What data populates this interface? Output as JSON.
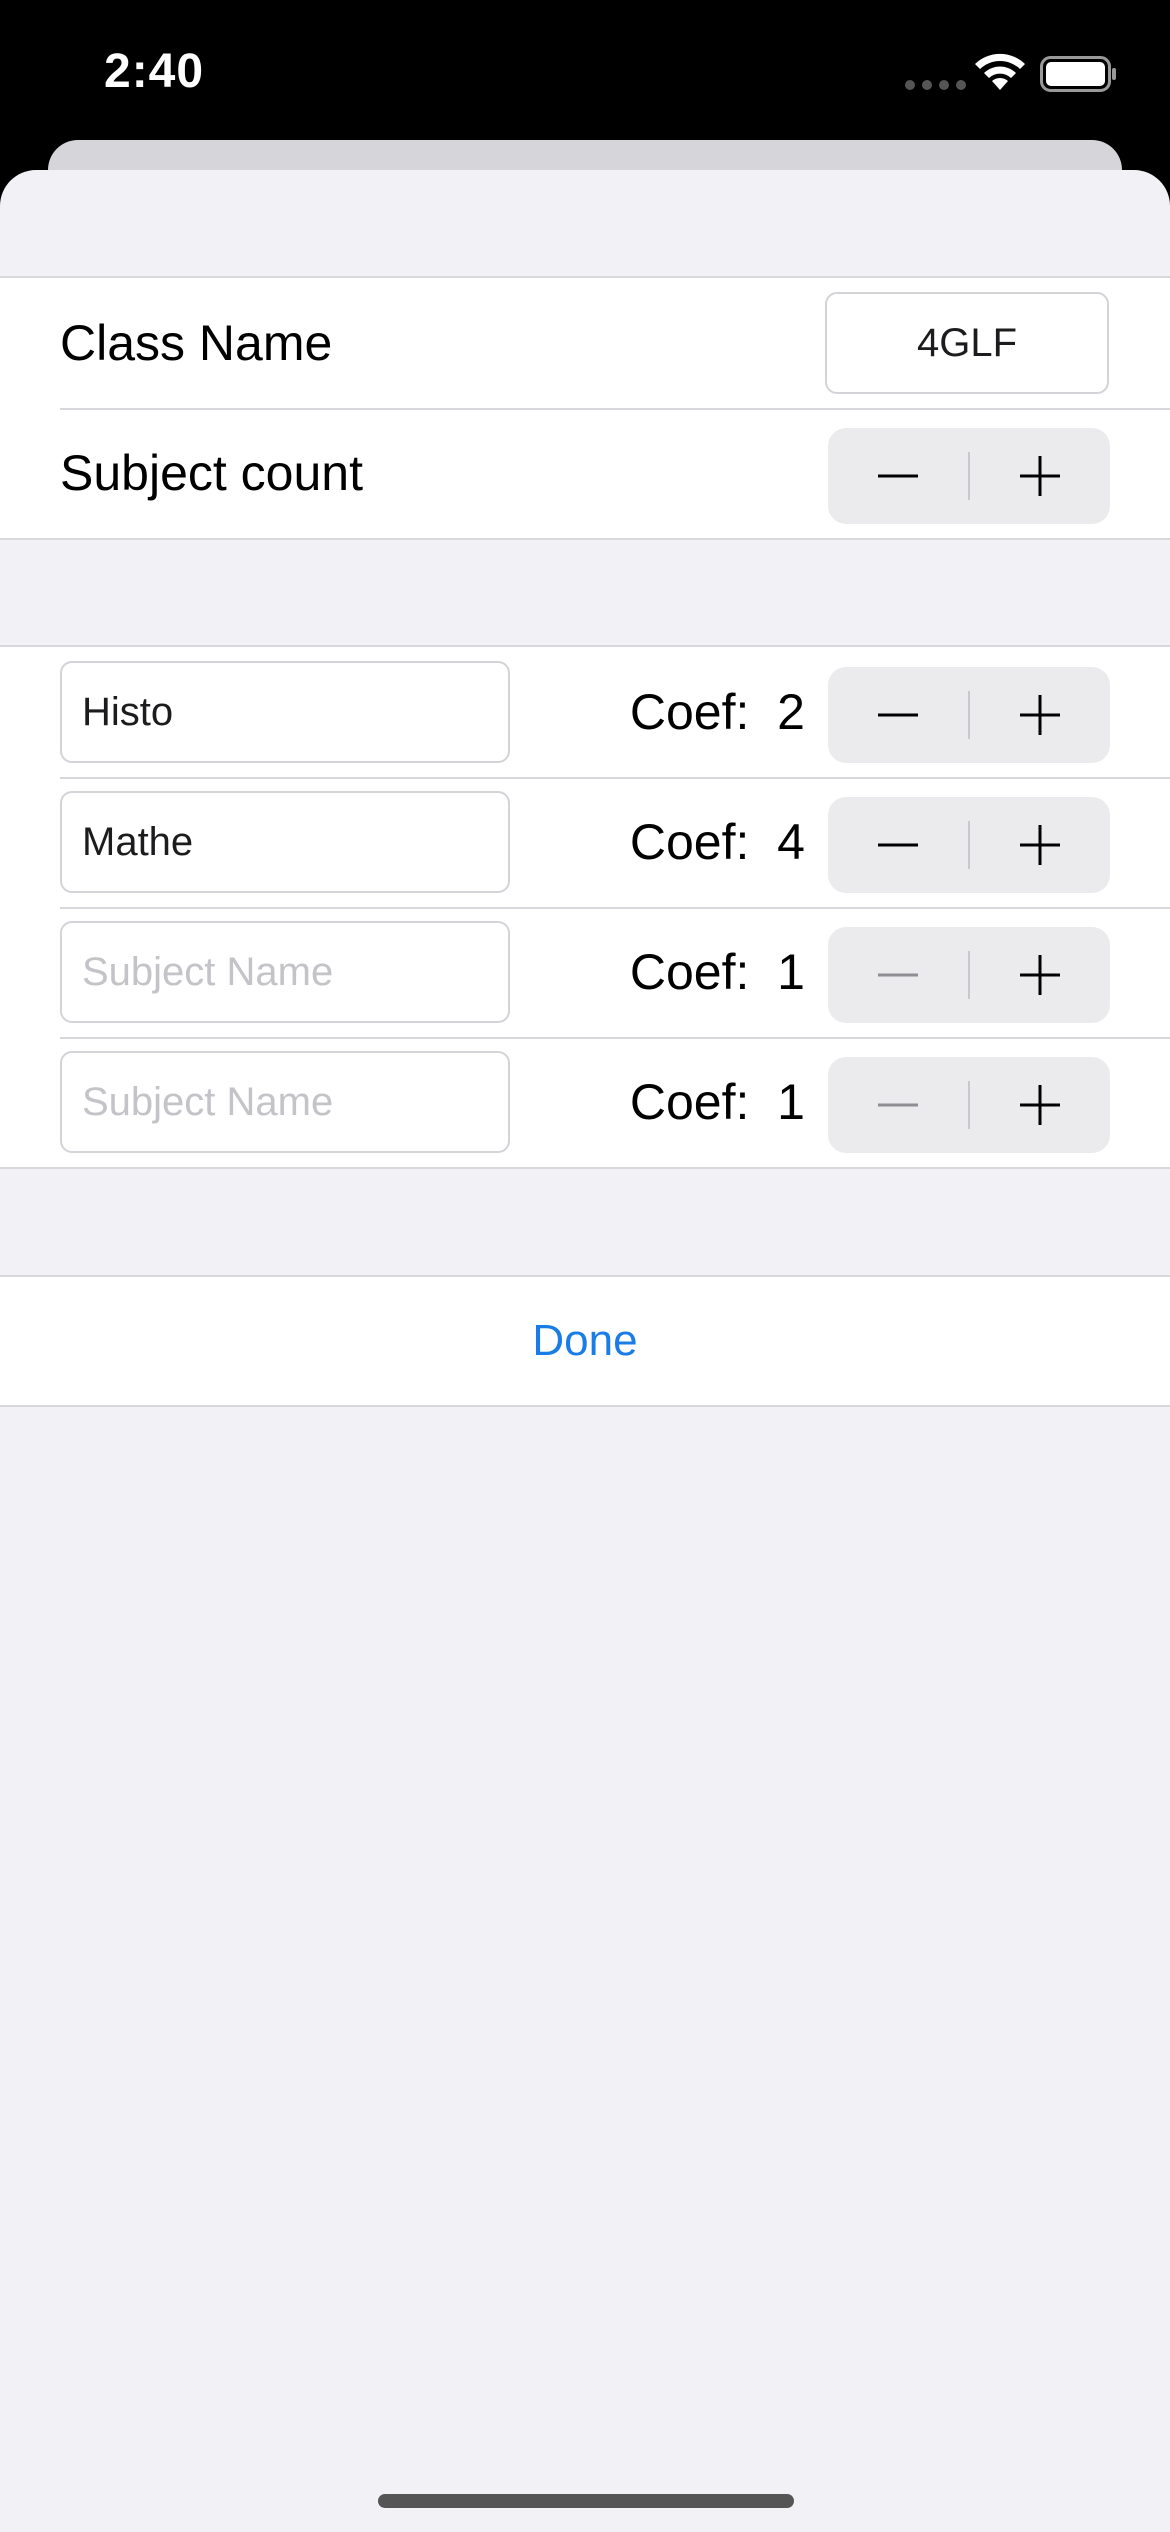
{
  "status_bar": {
    "time": "2:40"
  },
  "class_section": {
    "class_name_label": "Class Name",
    "class_name_value": "4GLF",
    "subject_count_label": "Subject count"
  },
  "subjects": [
    {
      "name": "Histo",
      "placeholder": "Subject Name",
      "coef_label": "Coef:  2"
    },
    {
      "name": "Mathe",
      "placeholder": "Subject Name",
      "coef_label": "Coef:  4"
    },
    {
      "name": "",
      "placeholder": "Subject Name",
      "coef_label": "Coef:  1"
    },
    {
      "name": "",
      "placeholder": "Subject Name",
      "coef_label": "Coef:  1"
    }
  ],
  "actions": {
    "done_label": "Done"
  },
  "colors": {
    "accent": "#1a7ce6",
    "background": "#f1f1f6"
  }
}
